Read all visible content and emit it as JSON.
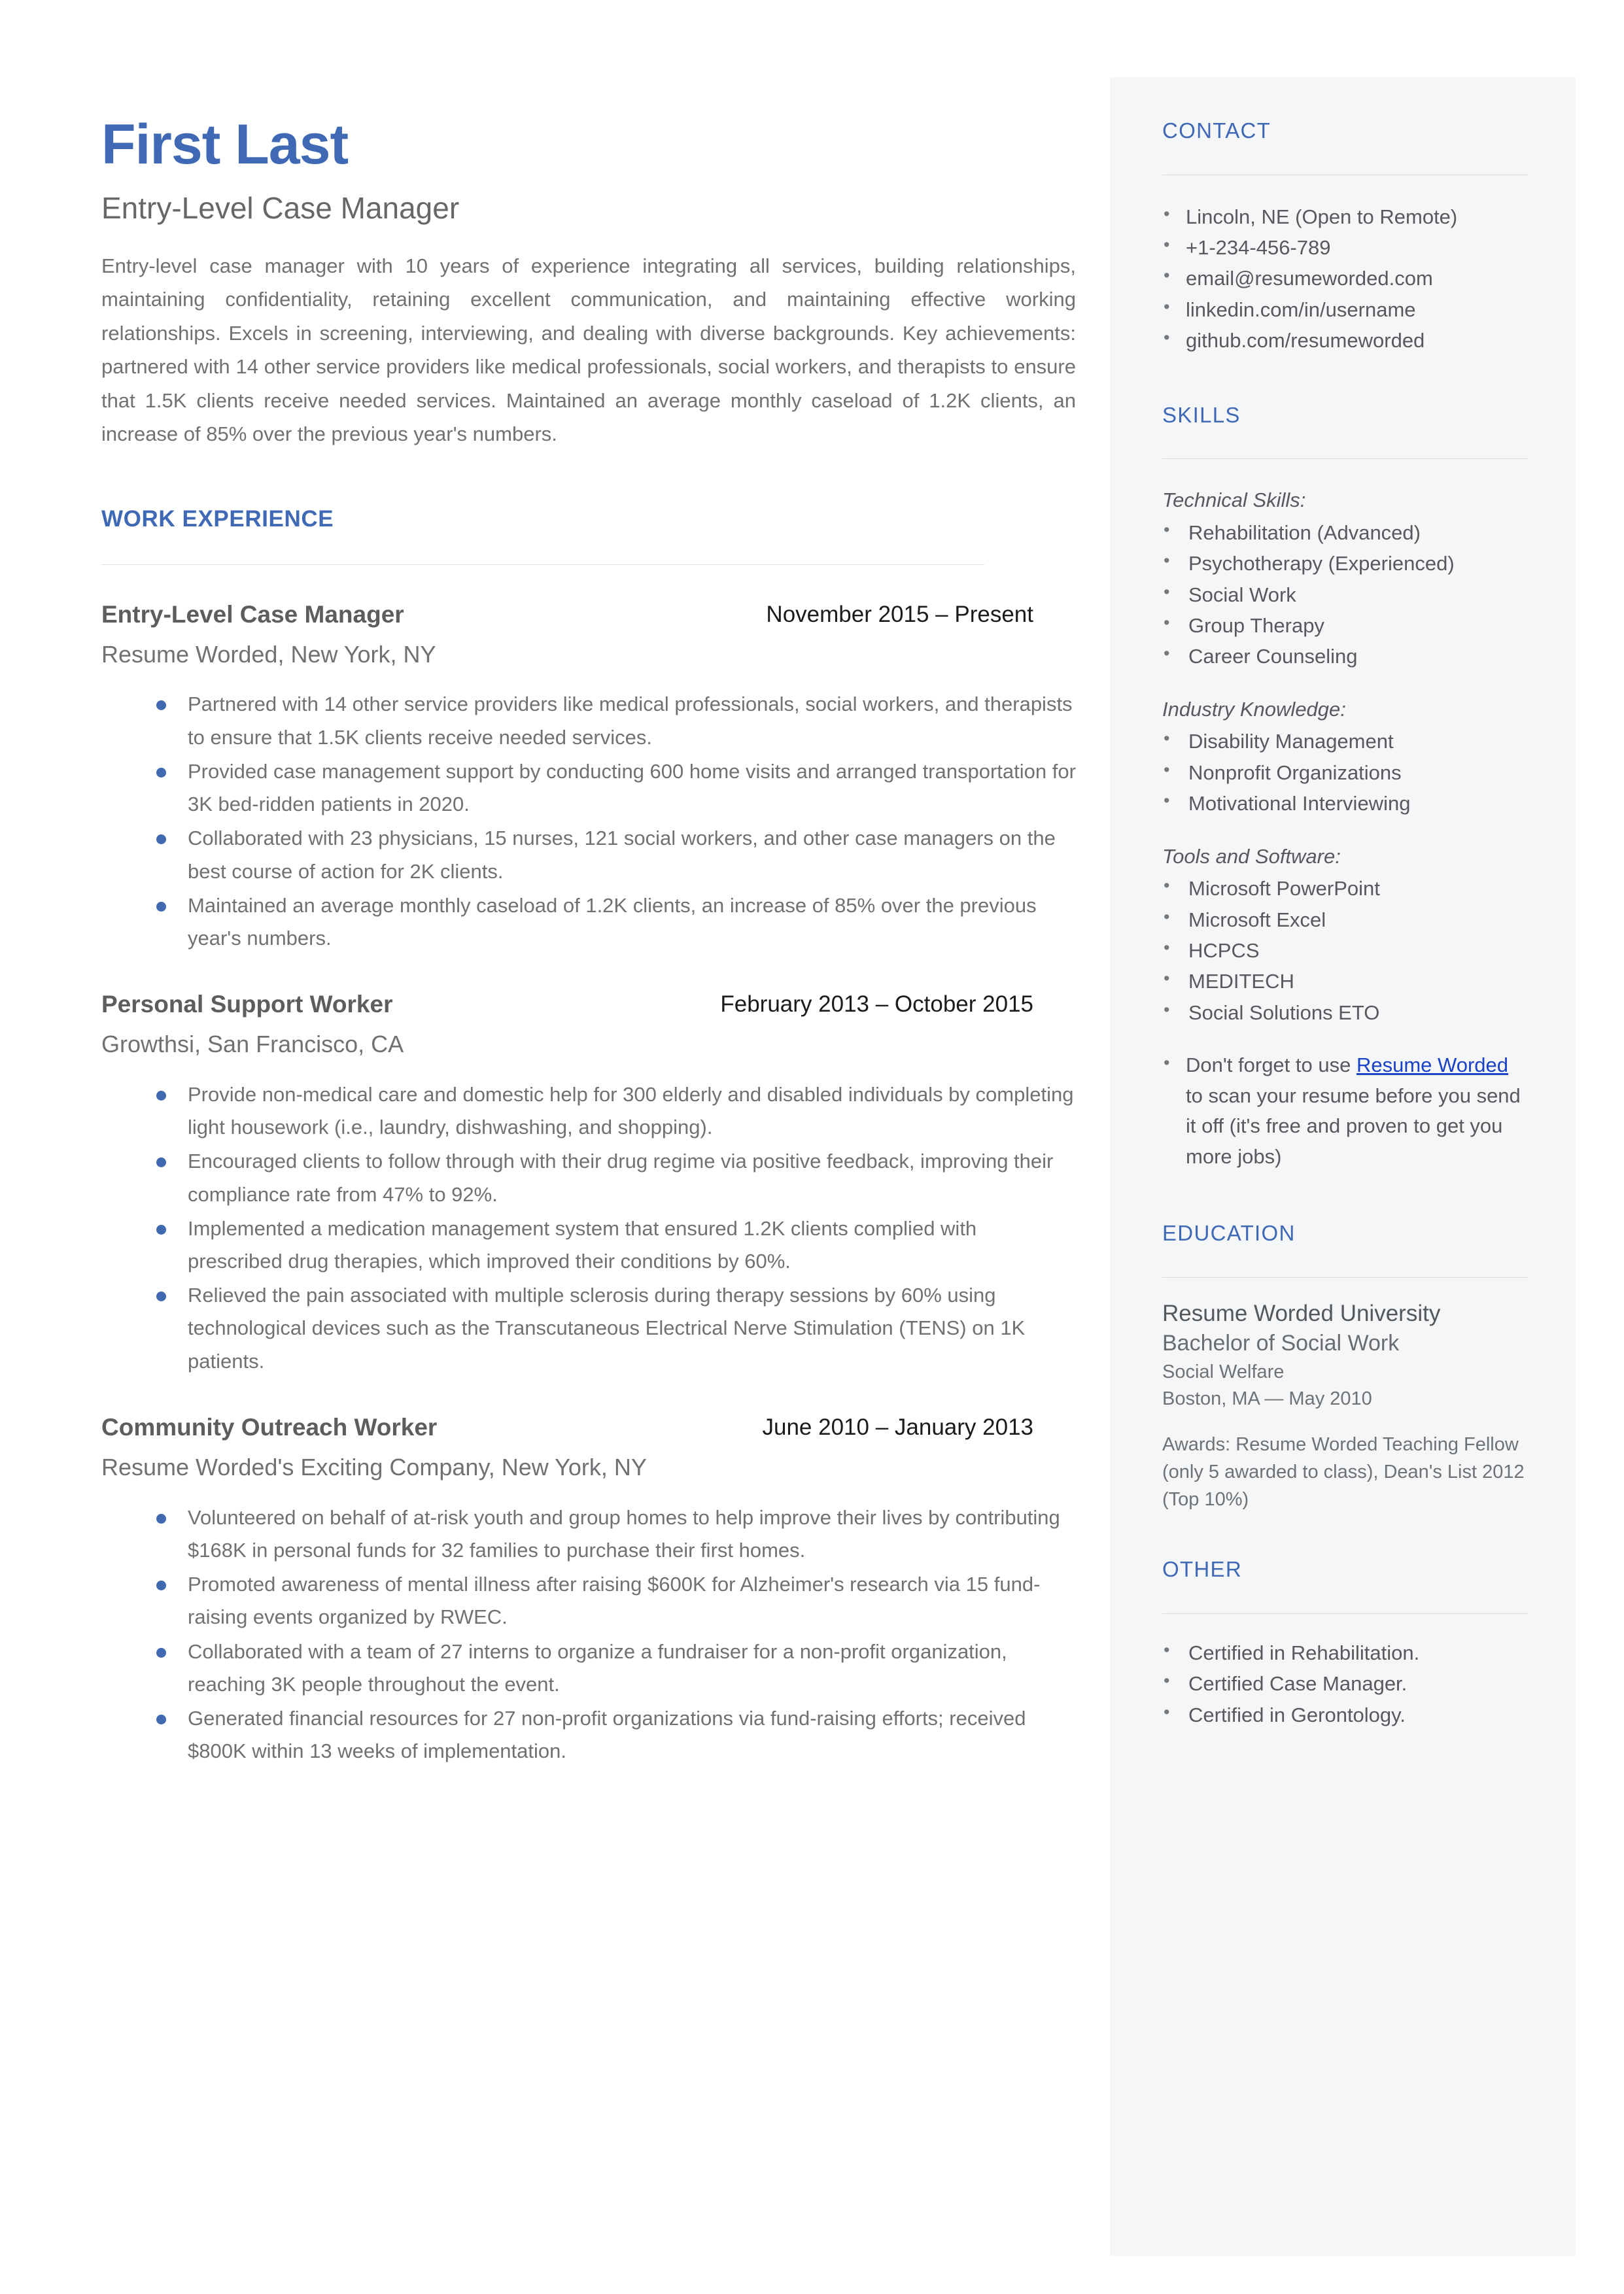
{
  "header": {
    "name": "First Last",
    "headline": "Entry-Level Case Manager",
    "summary": "Entry-level case manager with 10 years of experience integrating all services, building relationships, maintaining confidentiality, retaining excellent communication, and maintaining effective working relationships. Excels in screening, interviewing, and dealing with diverse backgrounds. Key achievements: partnered with 14 other service providers like medical professionals, social workers, and therapists to ensure that 1.5K clients receive needed services. Maintained an average monthly caseload of 1.2K clients, an increase of 85% over the previous year's numbers."
  },
  "work": {
    "heading": "WORK EXPERIENCE",
    "jobs": [
      {
        "title": "Entry-Level Case Manager",
        "dates": "November 2015 – Present",
        "company": "Resume Worded, New York, NY",
        "bullets": [
          "Partnered with 14 other service providers like medical professionals, social workers, and therapists to ensure that 1.5K clients receive needed services.",
          "Provided case management support by conducting 600 home visits and arranged transportation for 3K bed-ridden patients in 2020.",
          "Collaborated with 23 physicians, 15 nurses, 121 social workers, and other case managers on the best course of action for 2K clients.",
          "Maintained an average monthly caseload of 1.2K clients, an increase of 85% over the previous year's numbers."
        ]
      },
      {
        "title": "Personal Support Worker",
        "dates": "February 2013 – October 2015",
        "company": "Growthsi, San Francisco, CA",
        "bullets": [
          "Provide non-medical care and domestic help for 300 elderly and disabled individuals by completing light housework (i.e., laundry, dishwashing, and shopping).",
          "Encouraged clients to follow through with their drug regime via positive feedback, improving their compliance rate from 47% to 92%.",
          "Implemented a medication management system that ensured 1.2K clients complied with prescribed drug therapies, which improved their conditions by 60%.",
          "Relieved the pain associated with multiple sclerosis during therapy sessions by 60% using technological devices such as the Transcutaneous Electrical Nerve Stimulation (TENS) on 1K patients."
        ]
      },
      {
        "title": "Community Outreach Worker",
        "dates": "June 2010 – January 2013",
        "company": "Resume Worded's Exciting Company, New York, NY",
        "bullets": [
          "Volunteered on behalf of at-risk youth and group homes to help improve their lives by contributing $168K in personal funds for 32 families to purchase their first homes.",
          "Promoted awareness of mental illness after raising $600K for Alzheimer's research via 15 fund-raising events organized by RWEC.",
          "Collaborated with a team of 27 interns to organize a fundraiser for a non-profit organization, reaching 3K people throughout the event.",
          "Generated financial resources for 27 non-profit organizations via fund-raising efforts; received $800K within 13 weeks of implementation."
        ]
      }
    ]
  },
  "contact": {
    "heading": "CONTACT",
    "items": [
      "Lincoln, NE (Open to Remote)",
      "+1-234-456-789",
      "email@resumeworded.com",
      "linkedin.com/in/username",
      "github.com/resumeworded"
    ]
  },
  "skills": {
    "heading": "SKILLS",
    "groups": [
      {
        "label": "Technical Skills:",
        "items": [
          "Rehabilitation (Advanced)",
          "Psychotherapy (Experienced)",
          "Social Work",
          "Group Therapy",
          "Career Counseling"
        ]
      },
      {
        "label": "Industry Knowledge:",
        "items": [
          "Disability Management",
          "Nonprofit Organizations",
          "Motivational Interviewing"
        ]
      },
      {
        "label": "Tools and Software:",
        "items": [
          "Microsoft PowerPoint",
          "Microsoft Excel",
          "HCPCS",
          "MEDITECH",
          "Social Solutions ETO"
        ]
      }
    ],
    "promo": {
      "before": "Don't forget to use ",
      "link": "Resume Worded",
      "after": " to scan your resume before you send it off (it's free and proven to get you more jobs)"
    }
  },
  "education": {
    "heading": "EDUCATION",
    "school": "Resume Worded University",
    "degree": "Bachelor of Social Work",
    "field": "Social Welfare",
    "location": "Boston, MA — May 2010",
    "awards": "Awards: Resume Worded Teaching Fellow (only 5 awarded to class), Dean's List 2012 (Top 10%)"
  },
  "other": {
    "heading": "OTHER",
    "items": [
      "Certified in Rehabilitation.",
      "Certified Case Manager.",
      "Certified in Gerontology."
    ]
  },
  "colors": {
    "accent": "#3f69b5",
    "bullet": "#4169b2",
    "sidebar_bg": "#f4f6f8",
    "body_text": "#6f7174",
    "link": "#1a42c8"
  }
}
